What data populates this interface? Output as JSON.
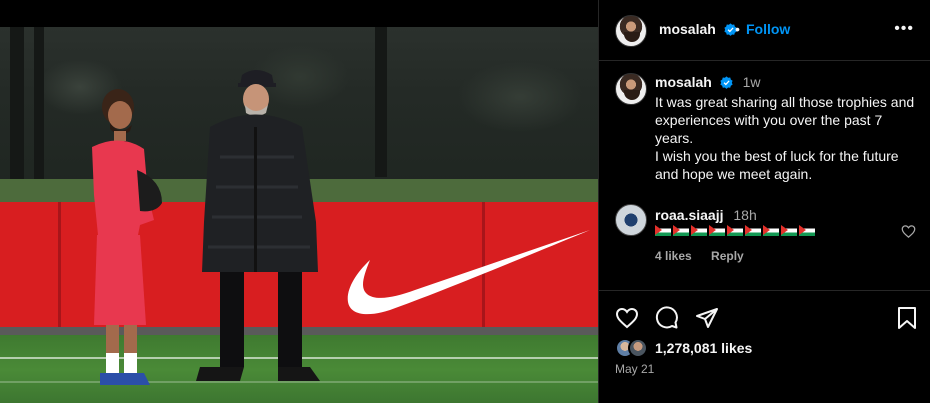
{
  "post": {
    "username": "mosalah",
    "follow_label": "Follow",
    "separator": "•",
    "more_label": "•••",
    "caption": {
      "username": "mosalah",
      "time": "1w",
      "text": "It was great sharing all those trophies and experiences with you over the past 7 years.\nI wish you the best of luck for the future and hope we meet again."
    },
    "comment": {
      "username": "roaa.siaajj",
      "time": "18h",
      "flag_count": 9,
      "likes": "4 likes",
      "reply": "Reply"
    },
    "likes_count": "1,278,081 likes",
    "date": "May 21"
  },
  "colors": {
    "accent": "#0095f6",
    "nike_red": "#d81e20",
    "secondary_text": "#a8a8a8"
  },
  "icons": {
    "verified": "verified-badge-icon",
    "like": "heart-icon",
    "comment": "comment-icon",
    "share": "share-icon",
    "save": "bookmark-icon",
    "more": "more-horizontal-icon"
  }
}
